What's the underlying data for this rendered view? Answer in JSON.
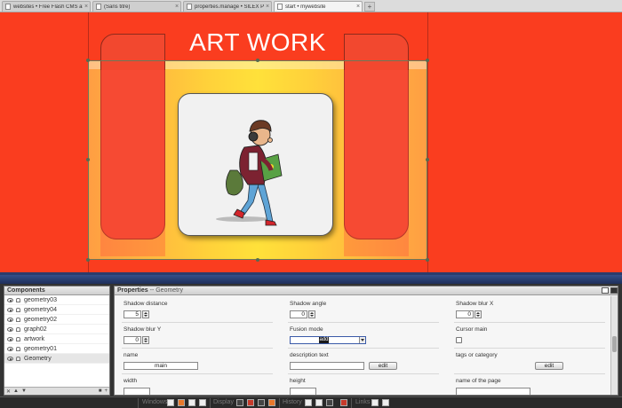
{
  "tabs": [
    {
      "label": "websites • Free Flash CMS and wysi...",
      "active": false
    },
    {
      "label": "(Sans titre)",
      "active": false
    },
    {
      "label": "properties.manage • SILEX PUBLICA...",
      "active": false
    },
    {
      "label": "start • mywebsite",
      "active": true
    }
  ],
  "stage": {
    "title": "ART WORK",
    "background_color": "#fa3d1f",
    "gradient_colors": [
      "#ff9e43",
      "#ffe13a"
    ]
  },
  "components": {
    "title": "Components",
    "items": [
      {
        "label": "geometry03",
        "selected": false
      },
      {
        "label": "geometry04",
        "selected": false
      },
      {
        "label": "geometry02",
        "selected": false
      },
      {
        "label": "graph02",
        "selected": false
      },
      {
        "label": "artwork",
        "selected": false
      },
      {
        "label": "geometry01",
        "selected": false
      },
      {
        "label": "Geometry",
        "selected": true
      }
    ]
  },
  "properties": {
    "title": "Properties",
    "subtitle": "-- Geometry",
    "shadow_distance": {
      "label": "Shadow distance",
      "value": "5"
    },
    "shadow_angle": {
      "label": "Shadow angle",
      "value": "0"
    },
    "shadow_blur_x": {
      "label": "Shadow blur X",
      "value": "0"
    },
    "shadow_blur_y": {
      "label": "Shadow blur Y",
      "value": "0"
    },
    "fusion_mode": {
      "label": "Fusion mode",
      "value": "add"
    },
    "cursor_main": {
      "label": "Cursor main"
    },
    "name": {
      "label": "name",
      "value": "main"
    },
    "description": {
      "label": "description text",
      "value": "",
      "edit_label": "edit"
    },
    "tags": {
      "label": "tags or category",
      "edit_label": "edit"
    },
    "width": {
      "label": "width"
    },
    "height": {
      "label": "height"
    },
    "page_name": {
      "label": "name of the page"
    }
  },
  "bottombar": {
    "windows_label": "Windows",
    "display_label": "Display",
    "history_label": "History",
    "help_label": "Links"
  }
}
